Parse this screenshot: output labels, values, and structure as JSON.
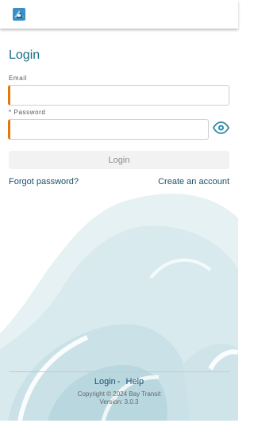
{
  "brand": {
    "logo_icon": "bay-transit-logo-icon"
  },
  "login": {
    "title": "Login",
    "email_label": "Email",
    "email_value": "",
    "password_label": "* Password",
    "password_value": "",
    "show_password_icon": "eye-icon",
    "submit_label": "Login",
    "forgot_password": "Forgot password?",
    "create_account": "Create an account"
  },
  "footer": {
    "links": [
      "Login",
      "Help"
    ],
    "separator": "-",
    "copyright": "Copyright © 2024 Bay Transit",
    "version": "Version: 3.0.3"
  },
  "colors": {
    "accent": "#1a6e86",
    "input_accent": "#e07a10",
    "wave_light": "#d7e9ec",
    "wave_mid": "#bcdbe2"
  }
}
